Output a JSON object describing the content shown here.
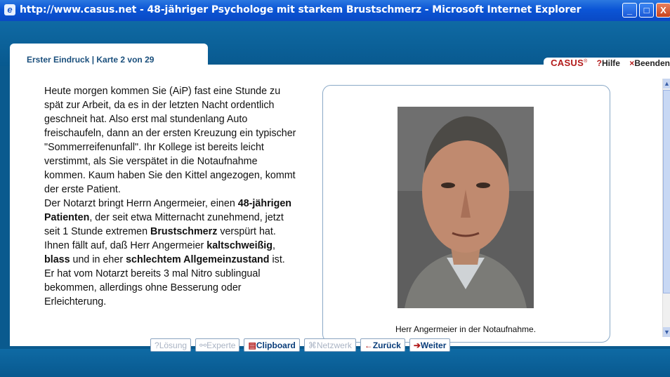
{
  "window": {
    "title": "http://www.casus.net - 48-jähriger Psychologe mit starkem Brustschmerz - Microsoft Internet Explorer",
    "minimize": "_",
    "maximize": "□",
    "close": "X"
  },
  "tab": {
    "label": "Erster Eindruck | Karte 2 von 29"
  },
  "toolbar": {
    "brand": "CASUS",
    "brand_sup": "®",
    "help_label": "Hilfe",
    "help_prefix": "?",
    "exit_label": "Beenden",
    "exit_prefix": "×"
  },
  "case_text": {
    "p1": "Heute morgen kommen Sie (AiP) fast eine Stunde zu spät zur Arbeit, da es in der letzten Nacht ordentlich geschneit hat. Also erst mal stundenlang Auto freischaufeln, dann an der ersten Kreuzung ein typischer \"Sommerreifenunfall\". Ihr Kollege ist bereits leicht verstimmt, als Sie verspätet in die Notaufnahme kommen. Kaum haben Sie den Kittel angezogen, kommt der erste Patient.",
    "p2_a": "Der Notarzt bringt Herrn Angermeier, einen ",
    "p2_b": "48-jährigen Patienten",
    "p2_c": ", der seit etwa Mitternacht zunehmend, jetzt seit 1 Stunde extremen ",
    "p2_d": "Brustschmerz",
    "p2_e": " verspürt hat. Ihnen fällt auf, daß Herr Angermeier ",
    "p2_f": "kaltschweißig",
    "p2_g": ", ",
    "p2_h": "blass",
    "p2_i": " und in eher ",
    "p2_j": "schlechtem Allgemeinzustand",
    "p2_k": " ist. Er hat vom Notarzt bereits 3 mal Nitro sublingual bekommen, allerdings ohne Besserung oder Erleichterung."
  },
  "image": {
    "caption": "Herr Angermeier in der Notaufnahme."
  },
  "nav": {
    "loesung": "Lösung",
    "loesung_icon": "?",
    "experte": "Experte",
    "experte_icon": "⚯",
    "clipboard": "Clipboard",
    "clipboard_icon": "▤",
    "netzwerk": "Netzwerk",
    "netzwerk_icon": "⌘",
    "zurueck": "Zurück",
    "zurueck_icon": "←",
    "weiter": "Weiter",
    "weiter_icon": "➔"
  }
}
